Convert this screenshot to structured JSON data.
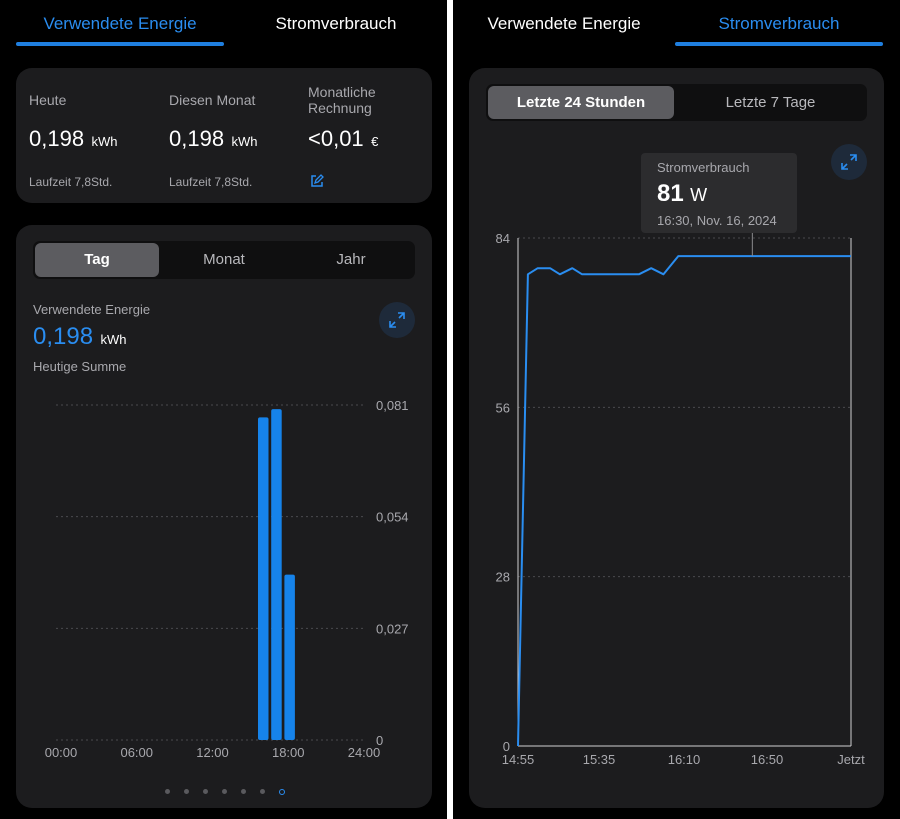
{
  "tabs": [
    {
      "label": "Verwendete Energie"
    },
    {
      "label": "Stromverbrauch"
    }
  ],
  "summary": {
    "today": {
      "title": "Heute",
      "value": "0,198",
      "unit": "kWh",
      "runtime": "Laufzeit 7,8Std."
    },
    "month": {
      "title": "Diesen Monat",
      "value": "0,198",
      "unit": "kWh",
      "runtime": "Laufzeit 7,8Std."
    },
    "bill": {
      "title": "Monatliche Rechnung",
      "value": "<0,01",
      "unit": "€",
      "edit_icon": "edit-icon"
    }
  },
  "period_segments": [
    {
      "label": "Tag",
      "selected": true
    },
    {
      "label": "Monat",
      "selected": false
    },
    {
      "label": "Jahr",
      "selected": false
    }
  ],
  "energy": {
    "label": "Verwendete Energie",
    "value": "0,198",
    "unit": "kWh",
    "sub": "Heutige Summe"
  },
  "range_segments": [
    {
      "label": "Letzte 24 Stunden",
      "selected": true
    },
    {
      "label": "Letzte 7 Tage",
      "selected": false
    }
  ],
  "tooltip": {
    "title": "Stromverbrauch",
    "value": "81",
    "unit": "W",
    "time": "16:30, Nov. 16, 2024"
  },
  "page_dots": {
    "count": 7,
    "active": 6
  },
  "colors": {
    "accent": "#2a8df0",
    "bar": "#1683ea",
    "line": "#2a8df0",
    "card": "#1c1c1e"
  },
  "chart_data": [
    {
      "type": "bar",
      "x_ticks": [
        "00:00",
        "06:00",
        "12:00",
        "18:00",
        "24:00"
      ],
      "y_ticks": [
        "0,081",
        "0,054",
        "0,027",
        "0"
      ],
      "ylim": [
        0,
        0.081
      ],
      "xlim_hours": [
        0,
        24
      ],
      "bars": [
        {
          "hour": 15,
          "value": 0.078
        },
        {
          "hour": 16,
          "value": 0.08
        },
        {
          "hour": 17,
          "value": 0.04
        }
      ],
      "grid": true
    },
    {
      "type": "line",
      "series_name": "Stromverbrauch",
      "x_ticks": [
        "14:55",
        "15:35",
        "16:10",
        "16:50",
        "Jetzt"
      ],
      "y_ticks": [
        "84",
        "56",
        "28",
        "0"
      ],
      "ylim": [
        0,
        84
      ],
      "points": [
        {
          "t": "14:55",
          "y": 0
        },
        {
          "t": "14:59",
          "y": 78
        },
        {
          "t": "15:03",
          "y": 79
        },
        {
          "t": "15:08",
          "y": 79
        },
        {
          "t": "15:12",
          "y": 78
        },
        {
          "t": "15:17",
          "y": 79
        },
        {
          "t": "15:21",
          "y": 78
        },
        {
          "t": "15:35",
          "y": 78
        },
        {
          "t": "15:44",
          "y": 78
        },
        {
          "t": "15:49",
          "y": 79
        },
        {
          "t": "15:54",
          "y": 78
        },
        {
          "t": "16:00",
          "y": 81
        },
        {
          "t": "16:10",
          "y": 81
        },
        {
          "t": "16:50",
          "y": 81
        },
        {
          "t": "17:10",
          "y": 81
        }
      ],
      "highlight_time": "16:30",
      "grid": true
    }
  ]
}
